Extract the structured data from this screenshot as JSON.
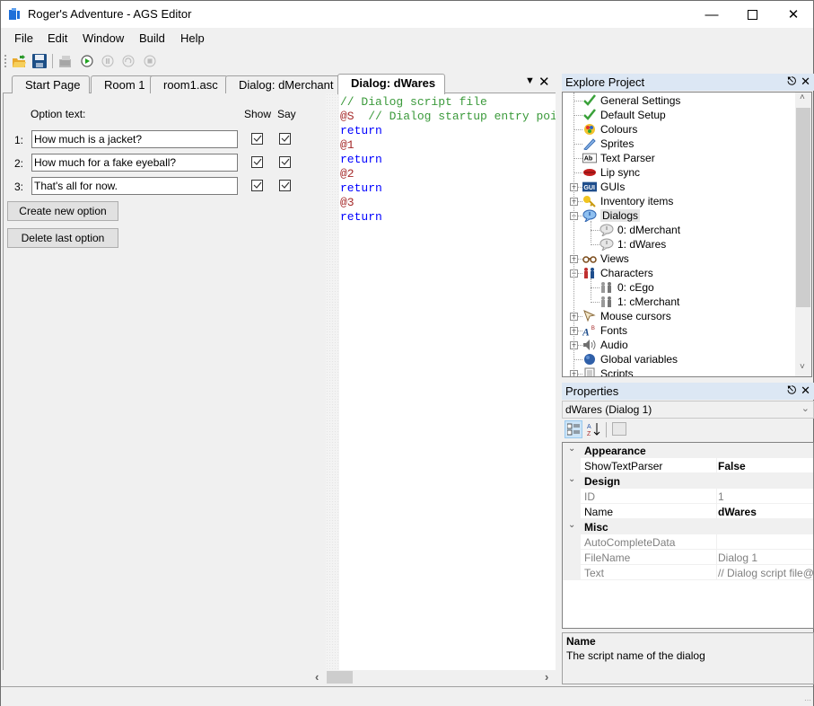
{
  "window": {
    "title": "Roger's Adventure - AGS Editor",
    "controls": [
      "minimize",
      "maximize",
      "close"
    ]
  },
  "menu": [
    "File",
    "Edit",
    "Window",
    "Build",
    "Help"
  ],
  "toolbar": {
    "icons": [
      "open-folder-icon",
      "save-icon",
      "build-icon",
      "run-icon",
      "pause-icon",
      "step-icon",
      "stop-icon"
    ]
  },
  "tabs": [
    {
      "label": "Start Page",
      "active": false
    },
    {
      "label": "Room 1",
      "active": false
    },
    {
      "label": "room1.asc",
      "active": false
    },
    {
      "label": "Dialog: dMerchant",
      "active": false
    },
    {
      "label": "Dialog: dWares",
      "active": true
    }
  ],
  "dialog_editor": {
    "option_text_label": "Option text:",
    "show_label": "Show",
    "say_label": "Say",
    "options": [
      {
        "num": "1:",
        "text": "How much is a jacket?",
        "show": true,
        "say": true
      },
      {
        "num": "2:",
        "text": "How much for a fake eyeball?",
        "show": true,
        "say": true
      },
      {
        "num": "3:",
        "text": "That's all for now.",
        "show": true,
        "say": true
      }
    ],
    "create_button": "Create new option",
    "delete_button": "Delete last option"
  },
  "script": {
    "lines": [
      {
        "parts": [
          {
            "t": "// Dialog script file",
            "c": "comment"
          }
        ]
      },
      {
        "parts": [
          {
            "t": "@S",
            "c": "label"
          },
          {
            "t": "  // Dialog startup entry point",
            "c": "comment"
          }
        ]
      },
      {
        "parts": [
          {
            "t": "return",
            "c": "kw"
          }
        ]
      },
      {
        "parts": [
          {
            "t": "@1",
            "c": "label"
          }
        ]
      },
      {
        "parts": [
          {
            "t": "return",
            "c": "kw"
          }
        ]
      },
      {
        "parts": [
          {
            "t": "@2",
            "c": "label"
          }
        ]
      },
      {
        "parts": [
          {
            "t": "return",
            "c": "kw"
          }
        ]
      },
      {
        "parts": [
          {
            "t": "@3",
            "c": "label"
          }
        ]
      },
      {
        "parts": [
          {
            "t": "return",
            "c": "kw"
          }
        ]
      }
    ]
  },
  "explorer": {
    "title": "Explore Project",
    "items": [
      {
        "label": "General Settings",
        "icon": "checkmark-icon",
        "level": 0,
        "expander": null
      },
      {
        "label": "Default Setup",
        "icon": "checkmark-icon",
        "level": 0,
        "expander": null
      },
      {
        "label": "Colours",
        "icon": "palette-icon",
        "level": 0,
        "expander": null
      },
      {
        "label": "Sprites",
        "icon": "sprite-icon",
        "level": 0,
        "expander": null
      },
      {
        "label": "Text Parser",
        "icon": "text-parser-icon",
        "level": 0,
        "expander": null
      },
      {
        "label": "Lip sync",
        "icon": "lips-icon",
        "level": 0,
        "expander": null
      },
      {
        "label": "GUIs",
        "icon": "gui-icon",
        "level": 0,
        "expander": "+"
      },
      {
        "label": "Inventory items",
        "icon": "key-icon",
        "level": 0,
        "expander": "+"
      },
      {
        "label": "Dialogs",
        "icon": "speech-bubble-icon",
        "level": 0,
        "expander": "-",
        "highlighted": true
      },
      {
        "label": "0: dMerchant",
        "icon": "speech-bubble-grey-icon",
        "level": 1,
        "expander": null
      },
      {
        "label": "1: dWares",
        "icon": "speech-bubble-grey-icon",
        "level": 1,
        "expander": null
      },
      {
        "label": "Views",
        "icon": "glasses-icon",
        "level": 0,
        "expander": "+"
      },
      {
        "label": "Characters",
        "icon": "characters-icon",
        "level": 0,
        "expander": "-"
      },
      {
        "label": "0: cEgo",
        "icon": "character-grey-icon",
        "level": 1,
        "expander": null
      },
      {
        "label": "1: cMerchant",
        "icon": "character-grey-icon",
        "level": 1,
        "expander": null
      },
      {
        "label": "Mouse cursors",
        "icon": "cursor-icon",
        "level": 0,
        "expander": "+"
      },
      {
        "label": "Fonts",
        "icon": "font-icon",
        "level": 0,
        "expander": "+"
      },
      {
        "label": "Audio",
        "icon": "speaker-icon",
        "level": 0,
        "expander": "+"
      },
      {
        "label": "Global variables",
        "icon": "globe-icon",
        "level": 0,
        "expander": null
      },
      {
        "label": "Scripts",
        "icon": "script-icon",
        "level": 0,
        "expander": "+"
      }
    ]
  },
  "properties": {
    "title": "Properties",
    "selected_object": "dWares (Dialog 1)",
    "categories": [
      {
        "name": "Appearance",
        "rows": [
          {
            "name": "ShowTextParser",
            "value": "False",
            "bold": true,
            "readonly": false
          }
        ]
      },
      {
        "name": "Design",
        "rows": [
          {
            "name": "ID",
            "value": "1",
            "bold": false,
            "readonly": true
          },
          {
            "name": "Name",
            "value": "dWares",
            "bold": true,
            "readonly": false
          }
        ]
      },
      {
        "name": "Misc",
        "rows": [
          {
            "name": "AutoCompleteData",
            "value": "",
            "bold": false,
            "readonly": true
          },
          {
            "name": "FileName",
            "value": "Dialog 1",
            "bold": false,
            "readonly": true
          },
          {
            "name": "Text",
            "value": "// Dialog script file@S",
            "bold": false,
            "readonly": true
          }
        ]
      }
    ],
    "description_title": "Name",
    "description_text": "The script name of the dialog"
  }
}
